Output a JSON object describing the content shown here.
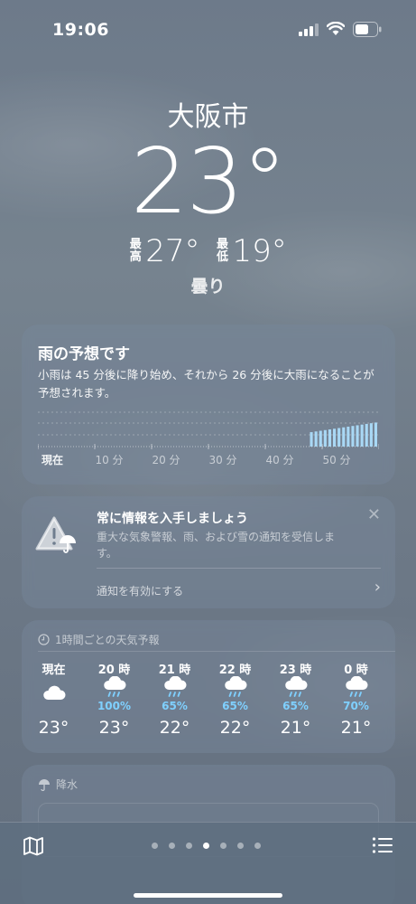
{
  "status_bar": {
    "time": "19:06"
  },
  "location": {
    "city": "大阪市",
    "temperature": "23°",
    "high_label": "最高",
    "high": "27°",
    "low_label": "最低",
    "low": "19°",
    "condition": "曇り"
  },
  "rain_card": {
    "title": "雨の予想です",
    "description": "小雨は 45 分後に降り始め、それから 26 分後に大雨になることが予想されます。",
    "axis_labels": [
      "現在",
      "10 分",
      "20 分",
      "30 分",
      "40 分",
      "50 分"
    ],
    "start_minute": 45,
    "bar_intensity": [
      0.42,
      0.44,
      0.46,
      0.48,
      0.5,
      0.52,
      0.54,
      0.56,
      0.58,
      0.6,
      0.62,
      0.64,
      0.66,
      0.68,
      0.7
    ]
  },
  "alert_card": {
    "title": "常に情報を入手しましょう",
    "description": "重大な気象警報、雨、および雪の通知を受信します。",
    "action": "通知を有効にする",
    "close_symbol": "✕",
    "chevron": "›"
  },
  "hourly_card": {
    "header": "1時間ごとの天気予報",
    "hours": [
      {
        "label": "現在",
        "icon": "cloud-icon",
        "prob": "",
        "temp": "23°"
      },
      {
        "label": "20 時",
        "icon": "rain-icon",
        "prob": "100%",
        "temp": "23°"
      },
      {
        "label": "21 時",
        "icon": "rain-icon",
        "prob": "65%",
        "temp": "22°"
      },
      {
        "label": "22 時",
        "icon": "rain-icon",
        "prob": "65%",
        "temp": "22°"
      },
      {
        "label": "23 時",
        "icon": "rain-icon",
        "prob": "65%",
        "temp": "21°"
      },
      {
        "label": "0 時",
        "icon": "rain-icon",
        "prob": "70%",
        "temp": "21°"
      }
    ]
  },
  "precip_card": {
    "header": "降水"
  },
  "bottom_bar": {
    "page_count": 7,
    "active_page": 3
  },
  "colors": {
    "accent_rain": "#7fd0ff",
    "bar_color": "#a9d8f5"
  }
}
